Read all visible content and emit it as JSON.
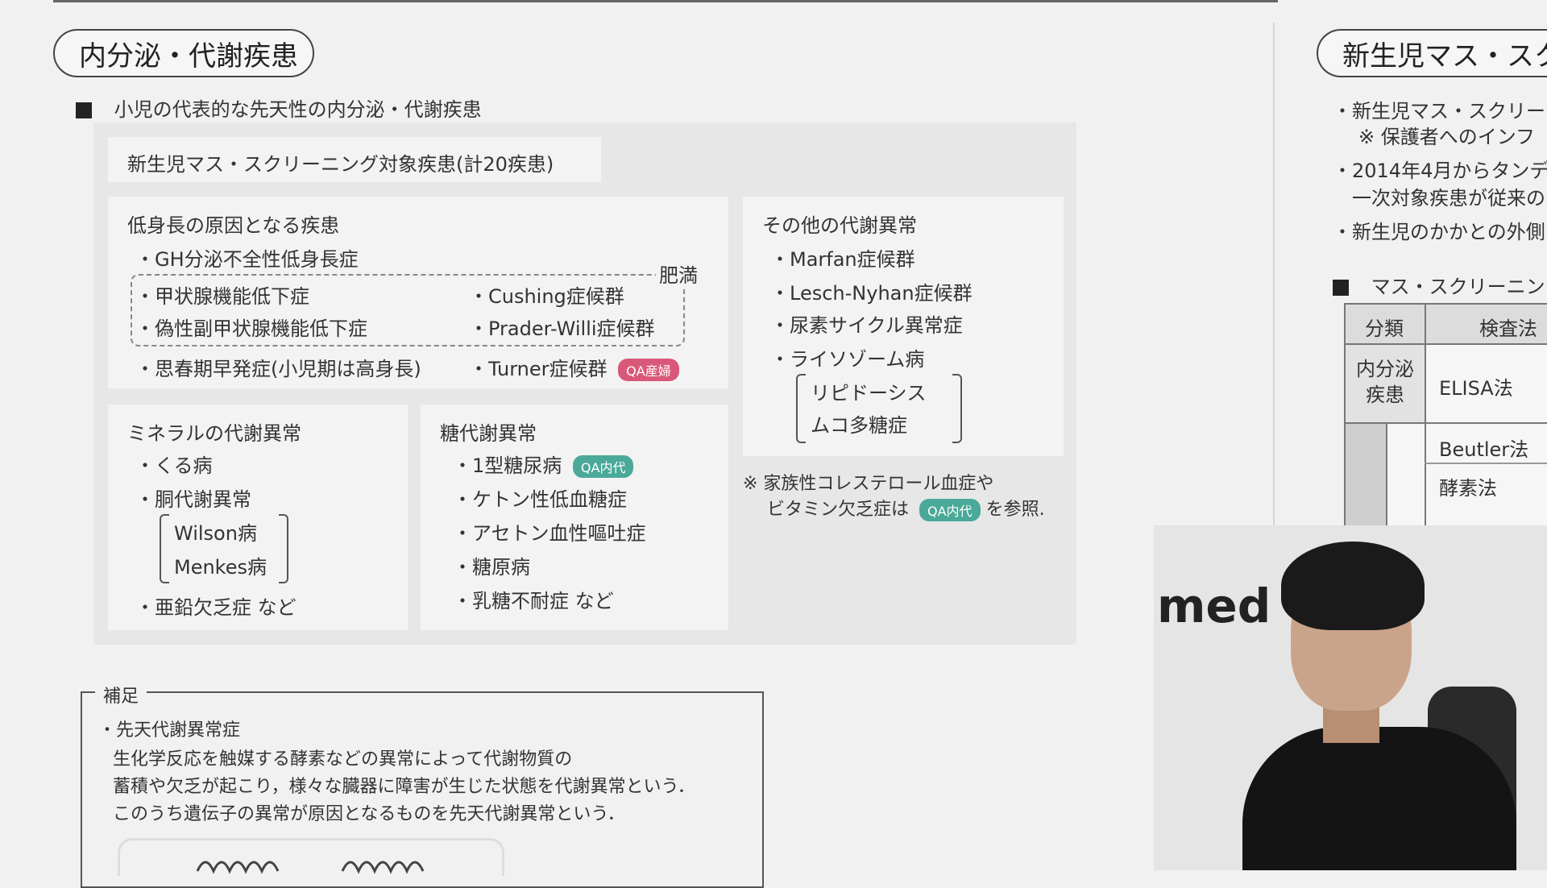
{
  "left": {
    "section_title": "内分泌・代謝疾患",
    "heading": "小児の代表的な先天性の内分泌・代謝疾患",
    "screening_label": "新生児マス・スクリーニング対象疾患(計20疾患)",
    "short_stature": {
      "title": "低身長の原因となる疾患",
      "items": [
        "・GH分泌不全性低身長症",
        "・甲状腺機能低下症",
        "・偽性副甲状腺機能低下症",
        "・思春期早発症(小児期は高身長)"
      ],
      "obesity_label": "肥満",
      "obesity_items": [
        "・Cushing症候群",
        "・Prader-Willi症候群"
      ],
      "turner": "・Turner症候群",
      "turner_tag": "QA産婦"
    },
    "mineral": {
      "title": "ミネラルの代謝異常",
      "items": [
        "・くる病",
        "・胴代謝異常",
        "・亜鉛欠乏症 など"
      ],
      "bracket_items": [
        "Wilson病",
        "Menkes病"
      ]
    },
    "sugar": {
      "title": "糖代謝異常",
      "item1": "・1型糖尿病",
      "item1_tag": "QA内代",
      "items": [
        "・ケトン性低血糖症",
        "・アセトン血性嘔吐症",
        "・糖原病",
        "・乳糖不耐症 など"
      ]
    },
    "other": {
      "title": "その他の代謝異常",
      "items": [
        "・Marfan症候群",
        "・Lesch-Nyhan症候群",
        "・尿素サイクル異常症",
        "・ライソゾーム病"
      ],
      "bracket_items": [
        "リピドーシス",
        "ムコ多糖症"
      ]
    },
    "note": {
      "line1": "※ 家族性コレステロール血症や",
      "line2a": "ビタミン欠乏症は",
      "tag": "QA内代",
      "line2b": "を参照."
    },
    "supplement": {
      "label": "補足",
      "title": "・先天代謝異常症",
      "lines": [
        "生化学反応を触媒する酵素などの異常によって代謝物質の",
        "蓄積や欠乏が起こり，様々な臓器に障害が生じた状態を代謝異常という．",
        "このうち遺伝子の異常が原因となるものを先天代謝異常という．"
      ]
    }
  },
  "right": {
    "section_title": "新生児マス・スク",
    "bullets": [
      "・新生児マス・スクリー",
      "※ 保護者へのインフ",
      "・2014年4月からタンデ",
      "一次対象疾患が従来の",
      "・新生児のかかとの外側"
    ],
    "heading": "マス・スクリーニン",
    "table": {
      "header_cat": "分類",
      "header_method": "検査法",
      "row1_cat": "内分泌 疾患",
      "row1_method": "ELISA法",
      "row2_method": "Beutler法",
      "row3_method": "酵素法"
    }
  },
  "video": {
    "logo_text": "med"
  },
  "colors": {
    "tag_pink": "#d9587a",
    "tag_teal": "#4aa998"
  }
}
